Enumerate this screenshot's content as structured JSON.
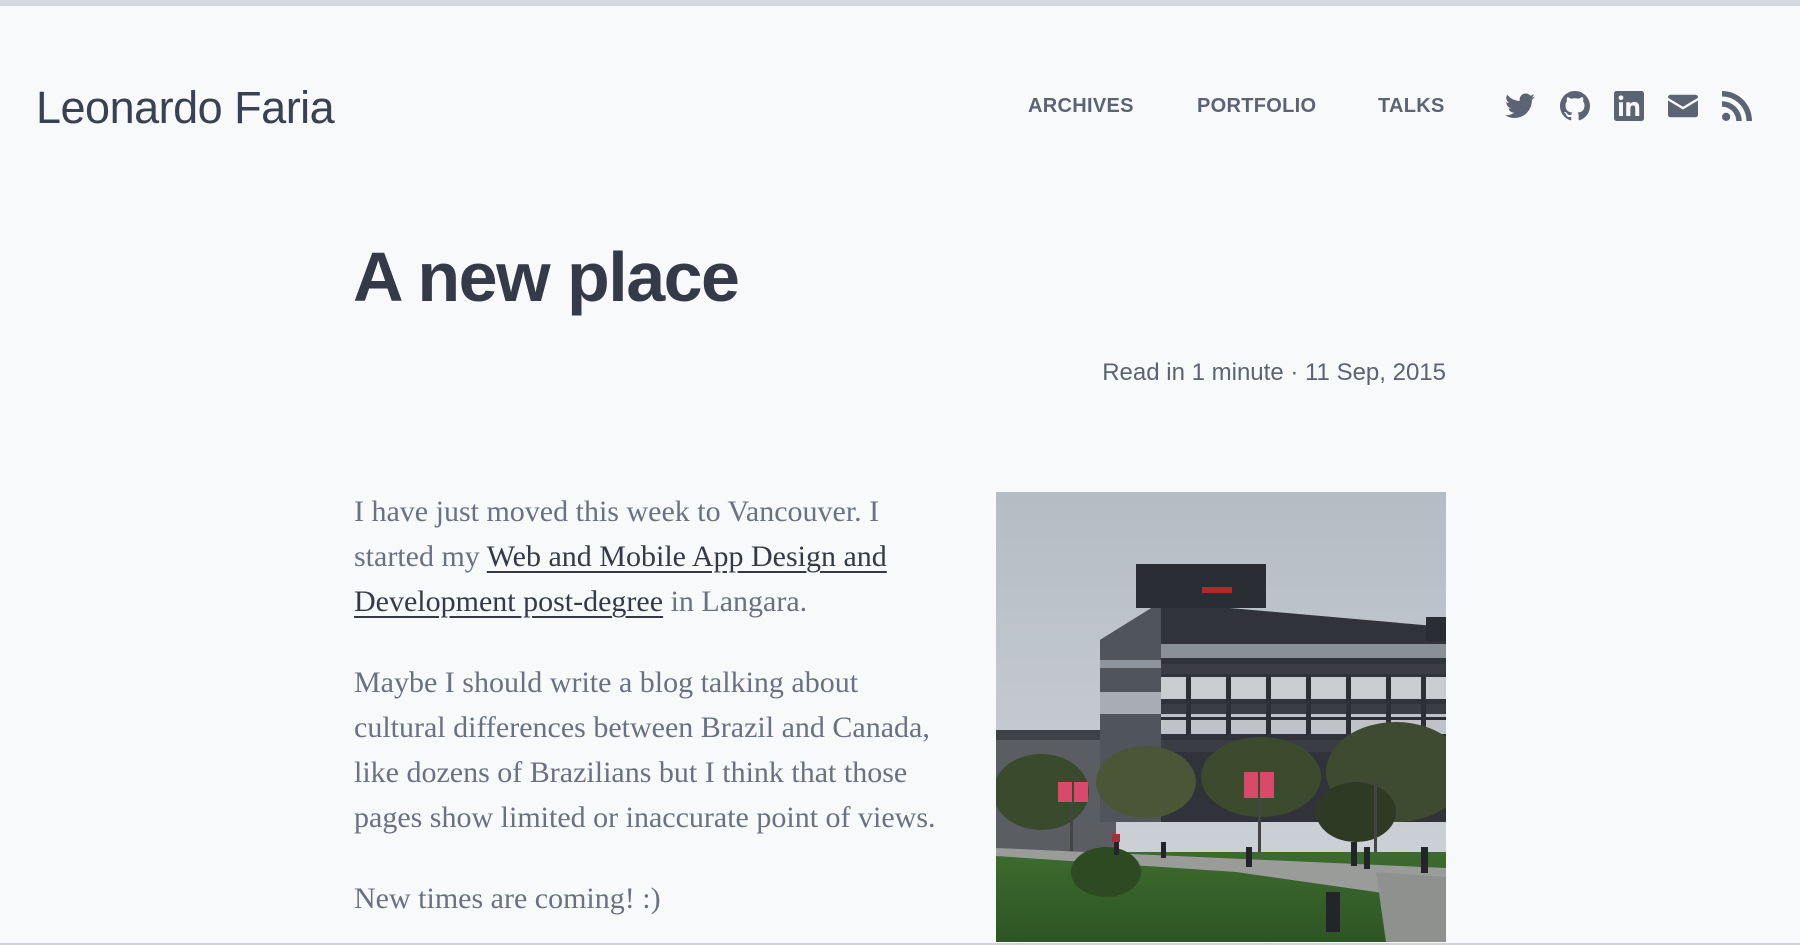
{
  "site": {
    "title": "Leonardo Faria"
  },
  "nav": {
    "items": [
      {
        "label": "ARCHIVES"
      },
      {
        "label": "PORTFOLIO"
      },
      {
        "label": "TALKS"
      }
    ],
    "social": [
      {
        "name": "twitter-icon"
      },
      {
        "name": "github-icon"
      },
      {
        "name": "linkedin-icon"
      },
      {
        "name": "email-icon"
      },
      {
        "name": "rss-icon"
      }
    ]
  },
  "post": {
    "title": "A new place",
    "meta": "Read in 1 minute · 11 Sep, 2015",
    "p1_start": "I have just moved this week to Vancouver. I started my ",
    "p1_link": "Web and Mobile App Design and Development post-degree",
    "p1_end": " in Langara.",
    "p2": "Maybe I should write a blog talking about cultural differences between Brazil and Canada, like dozens of Brazilians but I think that those pages show limited or inaccurate point of views.",
    "p3": "New times are coming! :)"
  },
  "colors": {
    "background": "#f8f9fb",
    "text": "#343a48",
    "muted": "#5c6373"
  }
}
